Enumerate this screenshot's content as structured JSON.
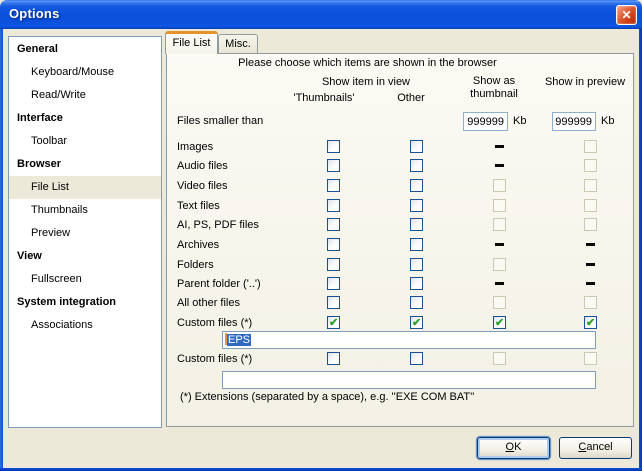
{
  "window": {
    "title": "Options",
    "close_glyph": "✕"
  },
  "colors": {
    "dialog_bg": "#ECE9D8",
    "titlebar_blue": "#0B51DC",
    "tab_accent_orange": "#E5912D",
    "selection_blue": "#316AC5",
    "check_green": "#2DA12D",
    "close_red": "#CC3C12",
    "edit_border": "#7F9DB9"
  },
  "sidebar": {
    "items": [
      {
        "label": "General",
        "type": "group",
        "selected": false
      },
      {
        "label": "Keyboard/Mouse",
        "type": "item",
        "selected": false
      },
      {
        "label": "Read/Write",
        "type": "item",
        "selected": false
      },
      {
        "label": "Interface",
        "type": "group",
        "selected": false
      },
      {
        "label": "Toolbar",
        "type": "item",
        "selected": false
      },
      {
        "label": "Browser",
        "type": "group",
        "selected": false
      },
      {
        "label": "File List",
        "type": "item",
        "selected": true
      },
      {
        "label": "Thumbnails",
        "type": "item",
        "selected": false
      },
      {
        "label": "Preview",
        "type": "item",
        "selected": false
      },
      {
        "label": "View",
        "type": "group",
        "selected": false
      },
      {
        "label": "Fullscreen",
        "type": "item",
        "selected": false
      },
      {
        "label": "System integration",
        "type": "group",
        "selected": false
      },
      {
        "label": "Associations",
        "type": "item",
        "selected": false
      }
    ]
  },
  "tabs": [
    {
      "label": "File List",
      "active": true
    },
    {
      "label": "Misc.",
      "active": false
    }
  ],
  "panel": {
    "instruction": "Please choose which items are shown in the browser",
    "columns": {
      "group": "Show item in view",
      "col1": "'Thumbnails'",
      "col2": "Other",
      "col3": "Show as\nthumbnail",
      "col4": "Show in preview"
    },
    "size_row": {
      "label": "Files smaller than",
      "value1": "999999",
      "unit1": "Kb",
      "value2": "999999",
      "unit2": "Kb"
    },
    "rows": [
      {
        "label": "Images",
        "c1": "unchecked",
        "c2": "unchecked",
        "c3": "dash",
        "c4": "disabled"
      },
      {
        "label": "Audio files",
        "c1": "unchecked",
        "c2": "unchecked",
        "c3": "dash",
        "c4": "disabled"
      },
      {
        "label": "Video files",
        "c1": "unchecked",
        "c2": "unchecked",
        "c3": "disabled",
        "c4": "disabled"
      },
      {
        "label": "Text files",
        "c1": "unchecked",
        "c2": "unchecked",
        "c3": "disabled",
        "c4": "disabled"
      },
      {
        "label": "AI, PS, PDF files",
        "c1": "unchecked",
        "c2": "unchecked",
        "c3": "disabled",
        "c4": "disabled"
      },
      {
        "label": "Archives",
        "c1": "unchecked",
        "c2": "unchecked",
        "c3": "dash",
        "c4": "dash"
      },
      {
        "label": "Folders",
        "c1": "unchecked",
        "c2": "unchecked",
        "c3": "disabled",
        "c4": "dash"
      },
      {
        "label": "Parent folder ('..')",
        "c1": "unchecked",
        "c2": "unchecked",
        "c3": "dash",
        "c4": "dash"
      },
      {
        "label": "All other files",
        "c1": "unchecked",
        "c2": "unchecked",
        "c3": "disabled",
        "c4": "disabled"
      },
      {
        "label": "Custom files (*)",
        "c1": "checked",
        "c2": "checked",
        "c3": "checked",
        "c4": "checked"
      },
      {
        "label": "Custom files (*)",
        "c1": "unchecked",
        "c2": "unchecked",
        "c3": "disabled",
        "c4": "disabled"
      }
    ],
    "custom1_value": "EPS",
    "custom2_value": "",
    "footnote": "(*) Extensions (separated by a space), e.g. ''EXE COM BAT''"
  },
  "buttons": {
    "ok": "OK",
    "cancel": "Cancel"
  }
}
